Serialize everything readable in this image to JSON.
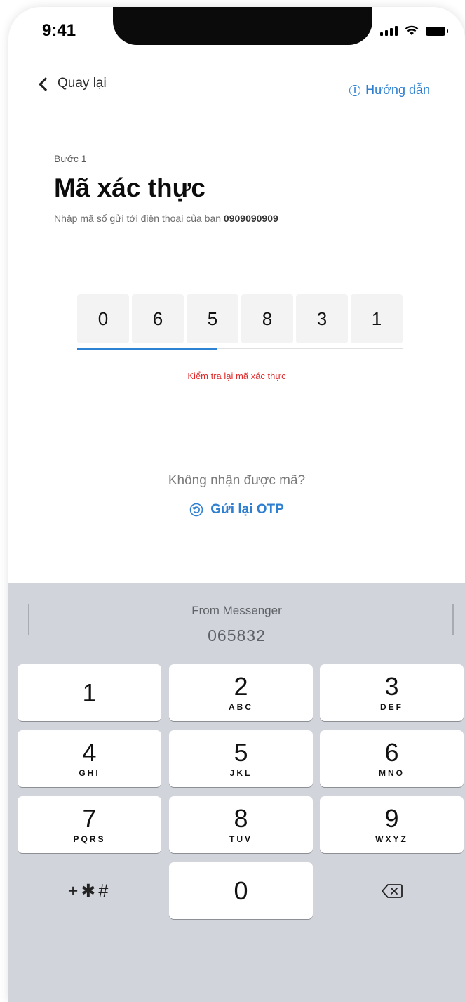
{
  "status_bar": {
    "time": "9:41"
  },
  "nav": {
    "back_label": "Quay lại",
    "guide_label": "Hướng dẫn"
  },
  "header": {
    "step": "Bước 1",
    "title": "Mã xác thực",
    "subtitle_prefix": "Nhập mã số gửi tới điện thoại của bạn ",
    "phone_number": "0909090909"
  },
  "otp": {
    "digits": [
      "0",
      "6",
      "5",
      "8",
      "3",
      "1"
    ],
    "progress_fraction": 0.43,
    "error_text": "Kiểm tra lại mã xác thực"
  },
  "resend": {
    "prompt": "Không nhận được mã?",
    "action_label": "Gửi lại OTP"
  },
  "keyboard": {
    "suggestion_source": "From Messenger",
    "suggestion_code": "065832",
    "keys": [
      {
        "num": "1",
        "letters": ""
      },
      {
        "num": "2",
        "letters": "ABC"
      },
      {
        "num": "3",
        "letters": "DEF"
      },
      {
        "num": "4",
        "letters": "GHI"
      },
      {
        "num": "5",
        "letters": "JKL"
      },
      {
        "num": "6",
        "letters": "MNO"
      },
      {
        "num": "7",
        "letters": "PQRS"
      },
      {
        "num": "8",
        "letters": "TUV"
      },
      {
        "num": "9",
        "letters": "WXYZ"
      }
    ],
    "symbols_label": "+✱#",
    "zero": "0"
  },
  "colors": {
    "accent": "#2f7fd1",
    "error": "#e02b2b",
    "keyboard_bg": "#d1d4da"
  }
}
